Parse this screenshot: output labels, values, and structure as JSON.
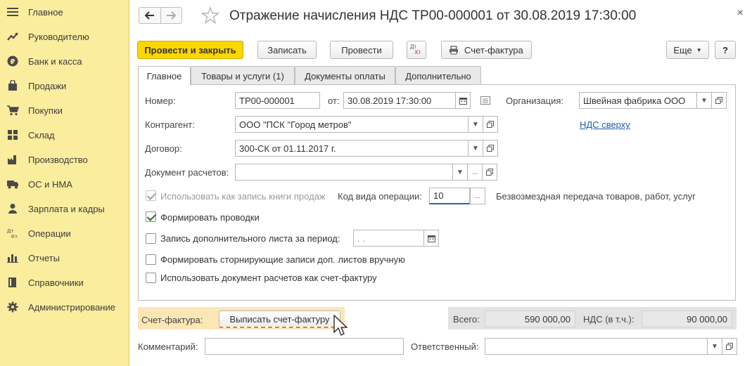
{
  "sidebar": {
    "items": [
      {
        "label": "Главное",
        "icon": "menu-icon"
      },
      {
        "label": "Руководителю",
        "icon": "trend-icon"
      },
      {
        "label": "Банк и касса",
        "icon": "ruble-coin-icon"
      },
      {
        "label": "Продажи",
        "icon": "shopping-bag-icon"
      },
      {
        "label": "Покупки",
        "icon": "cart-icon"
      },
      {
        "label": "Склад",
        "icon": "warehouse-icon"
      },
      {
        "label": "Производство",
        "icon": "factory-icon"
      },
      {
        "label": "ОС и НМА",
        "icon": "truck-icon"
      },
      {
        "label": "Зарплата и кадры",
        "icon": "person-icon"
      },
      {
        "label": "Операции",
        "icon": "dt-kt-icon"
      },
      {
        "label": "Отчеты",
        "icon": "bar-chart-icon"
      },
      {
        "label": "Справочники",
        "icon": "book-icon"
      },
      {
        "label": "Администрирование",
        "icon": "gear-icon"
      }
    ]
  },
  "window": {
    "title": "Отражение начисления НДС ТР00-000001 от 30.08.2019 17:30:00",
    "close_symbol": "×"
  },
  "toolbar": {
    "post_close_label": "Провести и закрыть",
    "save_label": "Записать",
    "post_label": "Провести",
    "dtkt_top": "Дт",
    "dtkt_bottom": "Кт",
    "invoice_label": "Счет-фактура",
    "more_label": "Еще",
    "help_label": "?"
  },
  "tabs": [
    {
      "label": "Главное",
      "active": true
    },
    {
      "label": "Товары и услуги (1)",
      "active": false
    },
    {
      "label": "Документы оплаты",
      "active": false
    },
    {
      "label": "Дополнительно",
      "active": false
    }
  ],
  "form": {
    "number_label": "Номер:",
    "number_value": "ТР00-000001",
    "date_label": "от:",
    "date_value": "30.08.2019 17:30:00",
    "org_label": "Организация:",
    "org_value": "Швейная фабрика ООО",
    "vat_link": "НДС сверху",
    "counterparty_label": "Контрагент:",
    "counterparty_value": "ООО \"ПСК \"Город метров\"",
    "contract_label": "Договор:",
    "contract_value": "300-СК от 01.11.2017 г.",
    "settlement_doc_label": "Документ расчетов:",
    "settlement_doc_value": "",
    "use_sales_book_label": "Использовать как запись книги продаж",
    "op_code_label": "Код вида операции:",
    "op_code_value": "10",
    "op_code_desc": "Безвозмездная передача товаров, работ, услуг",
    "make_entries_label": "Формировать проводки",
    "extra_sheet_label": "Запись дополнительного листа за период:",
    "extra_sheet_value": " .  .",
    "storno_label": "Формировать сторнирующие записи доп. листов вручную",
    "use_as_invoice_label": "Использовать документ расчетов как счет-фактуру",
    "ellipsis": "..."
  },
  "bottom": {
    "invoice_label": "Счет-фактура:",
    "issue_invoice_label": "Выписать счет-фактуру",
    "total_label": "Всего:",
    "total_value": "590 000,00",
    "vat_label": "НДС (в т.ч.):",
    "vat_value": "90 000,00",
    "comment_label": "Комментарий:",
    "comment_value": "",
    "responsible_label": "Ответственный:",
    "responsible_value": ""
  }
}
